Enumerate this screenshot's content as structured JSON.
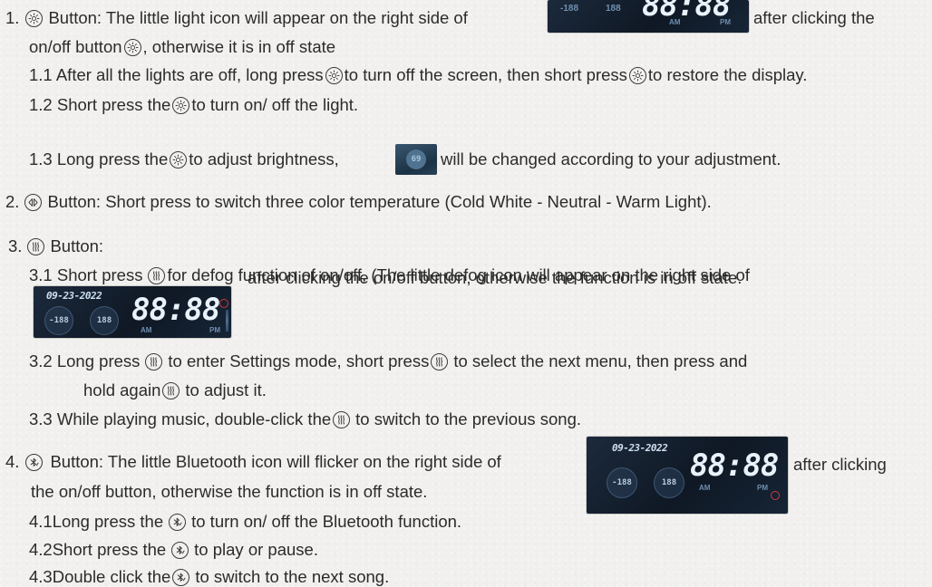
{
  "items": {
    "light": {
      "num": "1.",
      "title": "Button: The little light icon will appear on the right side of",
      "after": "after clicking the",
      "cont": "on/off button",
      "cont_after": ", otherwise it is in off state",
      "sub1": {
        "a": "1.1 After all the lights are off, long press",
        "b": "to turn off the screen, then short press",
        "c": "to restore the display."
      },
      "sub2": {
        "a": "1.2 Short press the",
        "b": "to turn on/ off the light."
      },
      "sub3": {
        "a": "1.3 Long press the",
        "b": "to adjust brightness,",
        "c": "will be changed according to your adjustment."
      }
    },
    "color": {
      "num": "2.",
      "title": "Button: Short press to switch three color temperature (Cold White - Neutral - Warm Light)."
    },
    "defog": {
      "num": "3.",
      "title": "Button:",
      "sub1": {
        "a": "3.1 Short press",
        "b": "for defog function of on/off, (The little defog icon will appear on the right side of"
      },
      "sub1_cont": "after clicking the on/off button, otherwise the function is in off state.",
      "sub2": {
        "a": "3.2 Long press",
        "b": "to enter Settings mode, short press",
        "c": "to select the next menu, then press and"
      },
      "sub2_cont": {
        "a": "hold again",
        "b": "to adjust it."
      },
      "sub3": {
        "a": "3.3 While playing music, double-click the",
        "b": "to switch to the previous song."
      }
    },
    "bluetooth": {
      "num": "4.",
      "title": "Button: The little Bluetooth icon will flicker on the right side of",
      "after": "after clicking",
      "cont": "the on/off button, otherwise the function is in off state.",
      "sub1": {
        "a": "4.1Long press the",
        "b": "to turn on/ off the Bluetooth function."
      },
      "sub2": {
        "a": "4.2Short press the",
        "b": "to play or pause."
      },
      "sub3": {
        "a": "4.3Double click the",
        "b": "to switch to the next song."
      }
    }
  },
  "display": {
    "date": "09-23-2022",
    "time": "88:88",
    "temp1": "-188",
    "temp2": "188",
    "am": "AM",
    "pm": "PM",
    "brightness": "69"
  },
  "colors": {
    "text": "#2b2b2b",
    "lcd_bg": "#0f1824",
    "indicator": "#d23a3a"
  },
  "icons": [
    "light-icon",
    "color-temperature-icon",
    "defog-icon",
    "bluetooth-icon"
  ]
}
